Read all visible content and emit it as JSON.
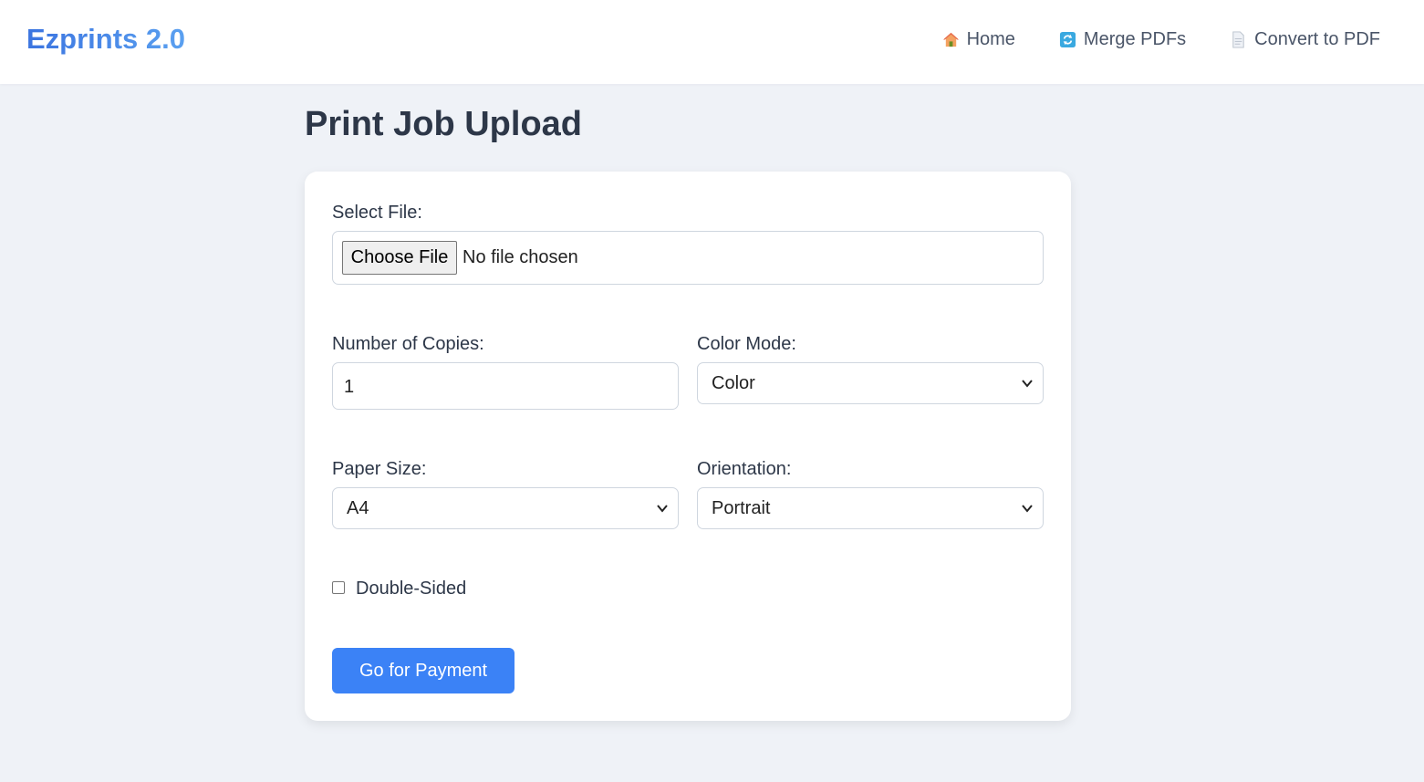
{
  "brand": "Ezprints 2.0",
  "nav": [
    {
      "label": "Home",
      "icon": "house-icon"
    },
    {
      "label": "Merge PDFs",
      "icon": "refresh-icon"
    },
    {
      "label": "Convert to PDF",
      "icon": "document-icon"
    }
  ],
  "page_title": "Print Job Upload",
  "form": {
    "file_label": "Select File:",
    "file_button": "Choose File",
    "file_status": "No file chosen",
    "copies_label": "Number of Copies:",
    "copies_value": "1",
    "color_label": "Color Mode:",
    "color_value": "Color",
    "paper_label": "Paper Size:",
    "paper_value": "A4",
    "orientation_label": "Orientation:",
    "orientation_value": "Portrait",
    "double_sided_label": "Double-Sided",
    "double_sided_checked": false,
    "submit_label": "Go for Payment"
  },
  "colors": {
    "accent": "#3b82f6",
    "background": "#eff2f7",
    "brand_start": "#3b74e0",
    "brand_end": "#5aa0f0"
  }
}
